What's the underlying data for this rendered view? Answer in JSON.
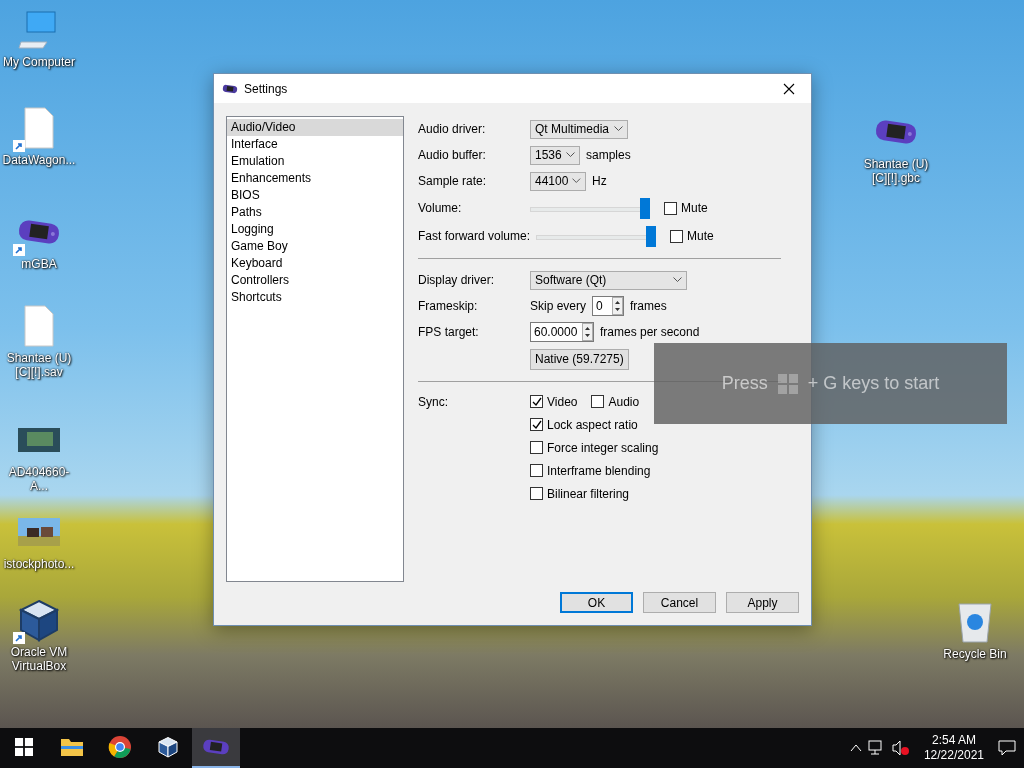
{
  "desktop": {
    "icons": [
      {
        "label": "My Computer",
        "kind": "computer",
        "shortcut": false
      },
      {
        "label": "DataWagon...",
        "kind": "file",
        "shortcut": true
      },
      {
        "label": "mGBA",
        "kind": "gba",
        "shortcut": true
      },
      {
        "label": "Shantae (U) [C][!].sav",
        "kind": "file",
        "shortcut": false
      },
      {
        "label": "AD404660-A...",
        "kind": "screenshot",
        "shortcut": false
      },
      {
        "label": "istockphoto...",
        "kind": "photo",
        "shortcut": false
      },
      {
        "label": "Oracle VM VirtualBox",
        "kind": "cube",
        "shortcut": true
      },
      {
        "label": "Shantae (U) [C][!].gbc",
        "kind": "gba",
        "shortcut": false
      },
      {
        "label": "Recycle Bin",
        "kind": "bin",
        "shortcut": false
      }
    ]
  },
  "window": {
    "title": "Settings",
    "sidebar": {
      "items": [
        {
          "label": "Audio/Video",
          "selected": true
        },
        {
          "label": "Interface",
          "selected": false
        },
        {
          "label": "Emulation",
          "selected": false
        },
        {
          "label": "Enhancements",
          "selected": false
        },
        {
          "label": "BIOS",
          "selected": false
        },
        {
          "label": "Paths",
          "selected": false
        },
        {
          "label": "Logging",
          "selected": false
        },
        {
          "label": "Game Boy",
          "selected": false
        },
        {
          "label": "Keyboard",
          "selected": false
        },
        {
          "label": "Controllers",
          "selected": false
        },
        {
          "label": "Shortcuts",
          "selected": false
        }
      ]
    },
    "sections": [
      {
        "rows": [
          {
            "label": "Audio driver:",
            "kind": "combo",
            "value": "Qt Multimedia"
          },
          {
            "label": "Audio buffer:",
            "kind": "combo",
            "value": "1536",
            "suffix": "samples"
          },
          {
            "label": "Sample rate:",
            "kind": "combo",
            "value": "44100",
            "suffix": "Hz"
          },
          {
            "label": "Volume:",
            "kind": "slider",
            "level": 1,
            "mute": {
              "label": "Mute",
              "checked": false
            }
          },
          {
            "label": "Fast forward volume:",
            "kind": "slider",
            "level": 1,
            "mute": {
              "label": "Mute",
              "checked": false
            }
          }
        ]
      },
      {
        "rows": [
          {
            "label": "Display driver:",
            "kind": "combo",
            "value": "Software (Qt)"
          },
          {
            "label": "Frameskip:",
            "kind": "spin",
            "prefix": "Skip every",
            "value": "0",
            "suffix": "frames"
          },
          {
            "label": "FPS target:",
            "kind": "spin",
            "value": "60.0000",
            "suffix": "frames per second"
          },
          {
            "kind": "button",
            "text": "Native (59.7275)"
          }
        ]
      },
      {
        "rows": [
          {
            "label": "Sync:",
            "kind": "checks",
            "options": [
              {
                "label": "Video",
                "checked": true
              },
              {
                "label": "Audio",
                "checked": false
              }
            ]
          },
          {
            "kind": "checks",
            "options": [
              {
                "label": "Lock aspect ratio",
                "checked": true
              }
            ]
          },
          {
            "kind": "checks",
            "options": [
              {
                "label": "Force integer scaling",
                "checked": false
              }
            ]
          },
          {
            "kind": "checks",
            "options": [
              {
                "label": "Interframe blending",
                "checked": false
              }
            ]
          },
          {
            "kind": "checks",
            "options": [
              {
                "label": "Bilinear filtering",
                "checked": false
              }
            ]
          }
        ]
      }
    ],
    "buttons": [
      {
        "label": "OK",
        "default": true
      },
      {
        "label": "Cancel",
        "default": false
      },
      {
        "label": "Apply",
        "default": false
      }
    ]
  },
  "toast": {
    "before": "Press",
    "after": "+ G keys to start"
  },
  "taskbar": {
    "apps": [
      {
        "kind": "folder",
        "running": false
      },
      {
        "kind": "browser",
        "running": false
      },
      {
        "kind": "cube",
        "running": false
      },
      {
        "kind": "gba",
        "running": true
      }
    ],
    "time": "2:54 AM",
    "date": "12/22/2021"
  }
}
